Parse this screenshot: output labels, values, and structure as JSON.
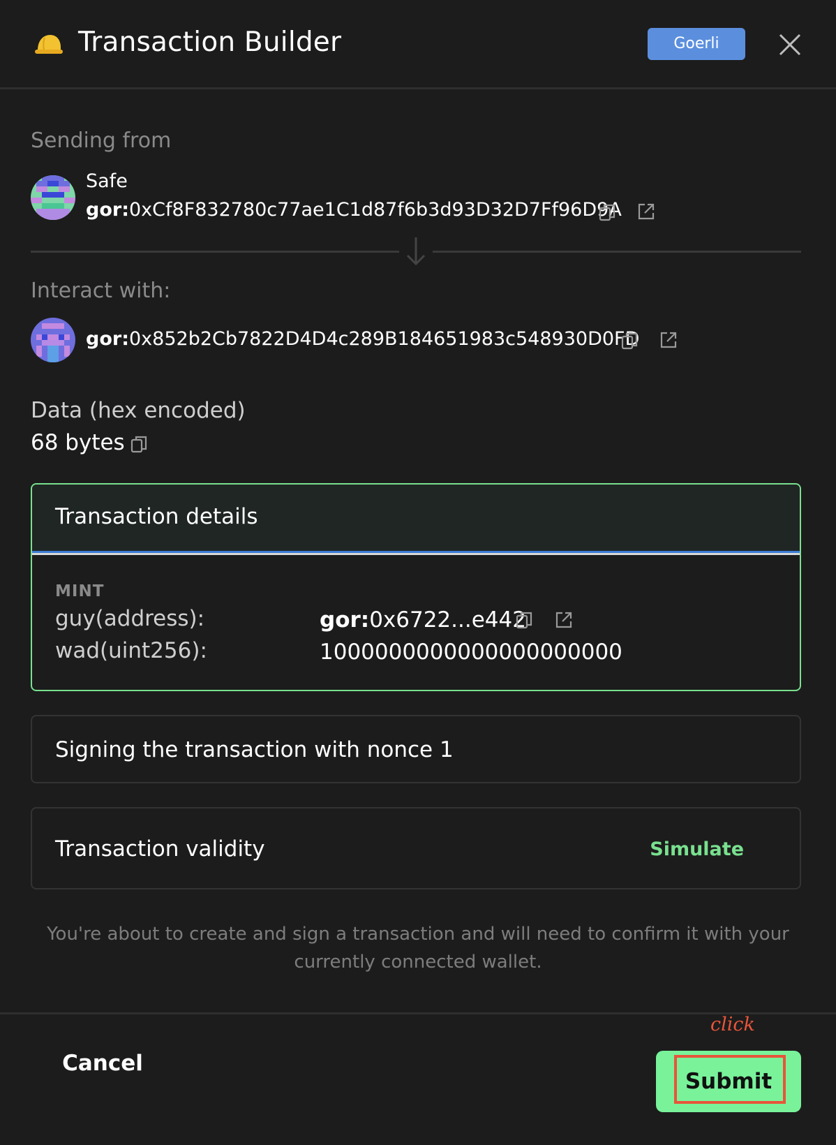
{
  "header": {
    "title": "Transaction Builder",
    "chain_badge": "Goerli"
  },
  "sender": {
    "section_label": "Sending from",
    "name": "Safe",
    "address_prefix": "gor:",
    "address": "0xCf8F832780c77ae1C1d87f6b3d93D32D7Ff96D9A"
  },
  "recipient": {
    "section_label": "Interact with:",
    "address_prefix": "gor:",
    "address": "0x852b2Cb7822D4D4c289B184651983c548930D0FD"
  },
  "data": {
    "label": "Data (hex encoded)",
    "value": "68 bytes"
  },
  "transaction_details": {
    "title": "Transaction details",
    "method": "MINT",
    "params": [
      {
        "name": "guy(address):",
        "prefix": "gor:",
        "value": "0x6722...e442"
      },
      {
        "name": "wad(uint256):",
        "value": "1000000000000000000000"
      }
    ]
  },
  "nonce_card": {
    "label": "Signing the transaction with nonce 1"
  },
  "validity_card": {
    "label": "Transaction validity",
    "action": "Simulate"
  },
  "notice": "You're about to create and sign a transaction and will need to confirm it with your currently connected wallet.",
  "footer": {
    "cancel_label": "Cancel",
    "submit_label": "Submit"
  },
  "annotation": {
    "click_label": "click"
  },
  "colors": {
    "accent_green": "#79f29a",
    "chain_blue": "#5b8fde",
    "highlight_red": "#e8553a"
  }
}
